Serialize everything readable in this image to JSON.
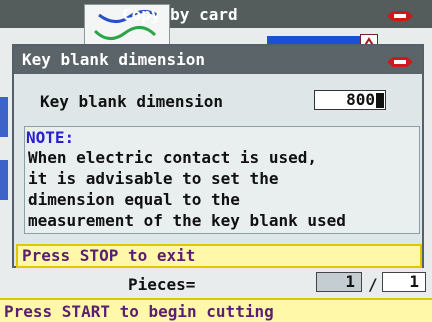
{
  "background": {
    "title": "Copy by card",
    "logo_icon": "silca-logo-icon",
    "pieces_label": "Pieces=",
    "pieces_done": "1",
    "pieces_separator": "/",
    "pieces_total": "1",
    "start_message": "Press START to begin cutting"
  },
  "dialog": {
    "title": "Key blank dimension",
    "logo_icon": "silca-logo-icon",
    "field_label": "Key blank dimension",
    "field_value": "800",
    "note": {
      "title": "NOTE:",
      "lines": [
        "When electric contact is used,",
        "it is advisable to set the",
        "dimension equal to the",
        "measurement of the key blank used"
      ]
    },
    "stop_message": "Press STOP to exit"
  },
  "colors": {
    "title_bar": "#5b6468",
    "message_bar": "#fff8a8",
    "message_text": "#5a1e72",
    "note_title": "#2a20d0",
    "logo_red": "#d01818"
  }
}
